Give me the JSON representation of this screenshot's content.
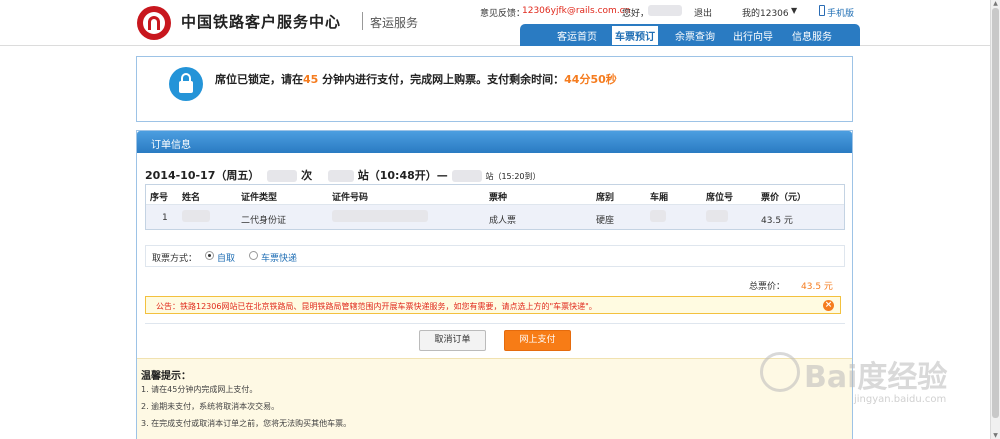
{
  "header": {
    "brand": "中国铁路客户服务中心",
    "sub_brand": "客运服务",
    "feedback_label": "意见反馈：",
    "feedback_email": "12306yjfk@rails.com.cn",
    "greeting": "您好，",
    "logout": "退出",
    "my12306": "我的12306",
    "mobile": "手机版"
  },
  "nav": {
    "items": [
      "客运首页",
      "车票预订",
      "余票查询",
      "出行向导",
      "信息服务"
    ],
    "active_index": 1
  },
  "lock_notice": {
    "prefix": "席位已锁定，请在",
    "minutes": "45",
    "middle": " 分钟内进行支付，完成网上购票。支付剩余时间：",
    "remaining": "44分50秒"
  },
  "order": {
    "title": "订单信息",
    "date": "2014-10-17（周五）",
    "train_suffix": "次",
    "from_suffix": "站（10:48开）—",
    "to_suffix": "站（15:20到）",
    "columns": [
      "序号",
      "姓名",
      "证件类型",
      "证件号码",
      "票种",
      "席别",
      "车厢",
      "席位号",
      "票价（元）"
    ],
    "rows": [
      {
        "seq": "1",
        "id_type": "二代身份证",
        "ticket_type": "成人票",
        "seat_class": "硬座",
        "price": "43.5 元"
      }
    ],
    "pickup_label": "取票方式：",
    "pickup_options": [
      "自取",
      "车票快递"
    ],
    "pickup_selected": 0,
    "total_label": "总票价：",
    "total_value": "43.5 元",
    "announcement": "公告：铁路12306网站已在北京铁路局、昆明铁路局管辖范围内开展车票快递服务，如您有需要，请点选上方的\"车票快递\"。",
    "cancel_button": "取消订单",
    "pay_button": "网上支付"
  },
  "tips": {
    "title": "温馨提示：",
    "items": [
      "1.  请在45分钟内完成网上支付。",
      "2.  逾期未支付，系统将取消本次交易。",
      "3.  在完成支付或取消本订单之前，您将无法购买其他车票。"
    ]
  },
  "watermark": {
    "text": "Bai度经验",
    "url": "jingyan.baidu.com"
  }
}
